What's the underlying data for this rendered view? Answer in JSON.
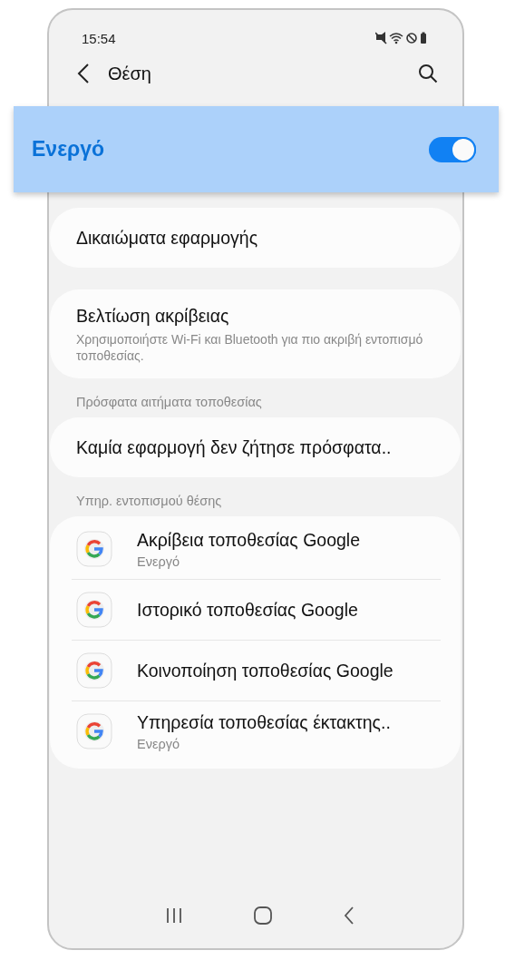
{
  "status_bar": {
    "time": "15:54"
  },
  "header": {
    "title": "Θέση"
  },
  "master_switch": {
    "label": "Ενεργό",
    "on": true
  },
  "app_permissions": {
    "title": "Δικαιώματα εφαρμογής"
  },
  "accuracy": {
    "title": "Βελτίωση ακρίβειας",
    "subtitle": "Χρησιμοποιήστε Wi-Fi και Bluetooth για πιο ακριβή εντοπισμό τοποθεσίας."
  },
  "recent_requests": {
    "heading": "Πρόσφατα αιτήματα τοποθεσίας",
    "text": "Καμία εφαρμογή δεν ζήτησε πρόσφατα.."
  },
  "location_services": {
    "heading": "Υπηρ. εντοπισμού θέσης",
    "items": [
      {
        "title": "Ακρίβεια τοποθεσίας Google",
        "subtitle": "Ενεργό"
      },
      {
        "title": "Ιστορικό τοποθεσίας Google"
      },
      {
        "title": "Κοινοποίηση τοποθεσίας Google"
      },
      {
        "title": "Υπηρεσία τοποθεσίας έκτακτης..",
        "subtitle": "Ενεργό"
      }
    ]
  }
}
